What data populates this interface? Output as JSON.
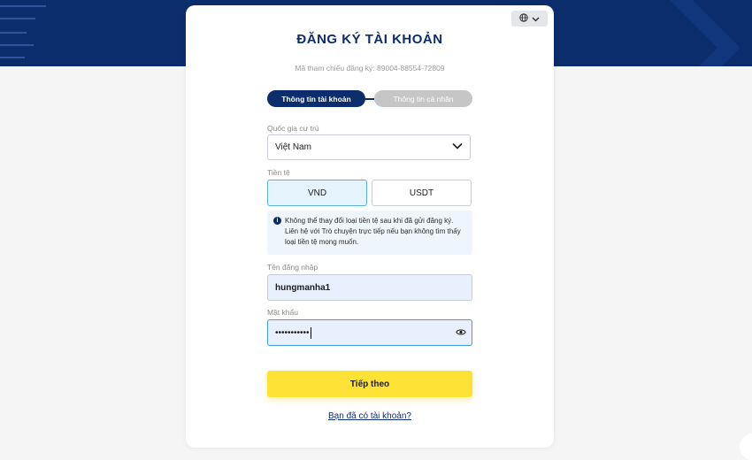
{
  "header": {
    "title": "ĐĂNG KÝ TÀI KHOẢN",
    "reference_text": "Mã tham chiếu đăng ký: 89004-88554-72809",
    "language_icon": "globe-icon"
  },
  "steps": [
    {
      "label": "Thông tin tài khoản",
      "state": "active"
    },
    {
      "label": "Thông tin cá nhân",
      "state": "inactive"
    }
  ],
  "form": {
    "country": {
      "label": "Quốc gia cư trú",
      "value": "Việt Nam"
    },
    "currency": {
      "label": "Tiền tệ",
      "options": [
        "VND",
        "USDT"
      ],
      "selected": "VND"
    },
    "notice": {
      "icon": "info-icon",
      "text": "Không thể thay đổi loại tiền tệ sau khi đã gửi đăng ký. Liên hệ với Trò chuyện trực tiếp nếu bạn không tìm thấy loại tiền tệ mong muốn."
    },
    "username": {
      "label": "Tên đăng nhập",
      "value": "hungmanha1"
    },
    "password": {
      "label": "Mật khẩu",
      "value": "•••••••••••"
    },
    "submit_label": "Tiếp theo",
    "login_link": "Bạn đã có tài khoản?"
  },
  "colors": {
    "brand_navy": "#0c2d6b",
    "accent_yellow": "#ffe236",
    "selected_blue": "#5ab0e6"
  }
}
